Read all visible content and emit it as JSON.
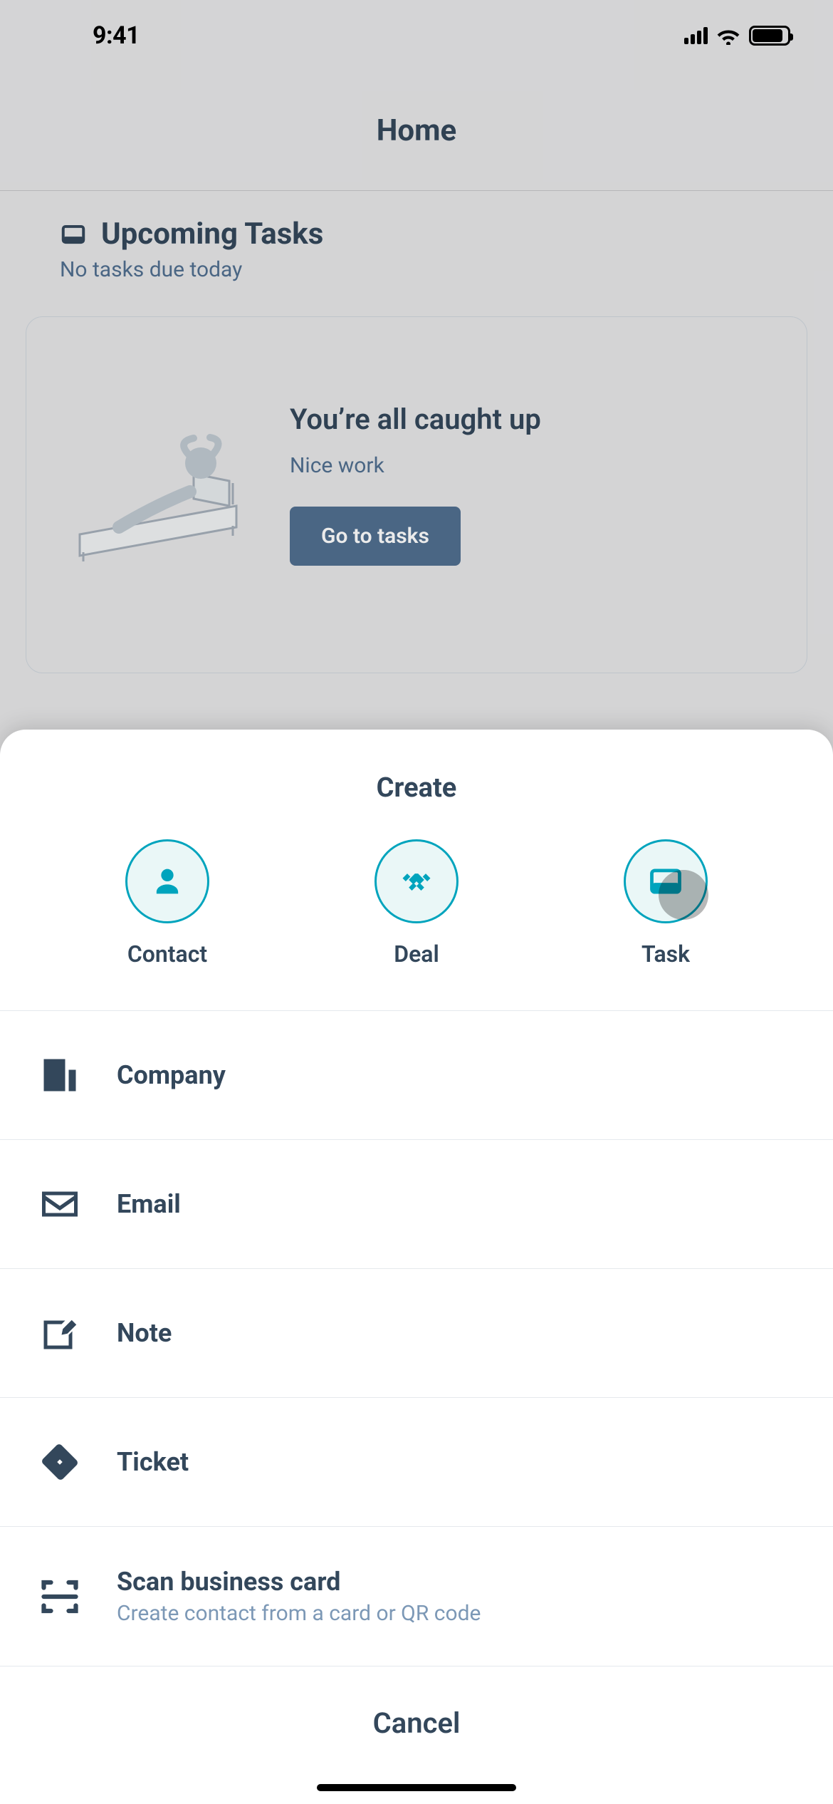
{
  "status": {
    "time": "9:41"
  },
  "header": {
    "title": "Home"
  },
  "upcoming": {
    "title": "Upcoming Tasks",
    "subtitle": "No tasks due today"
  },
  "card": {
    "title": "You’re all caught up",
    "subtitle": "Nice work",
    "button": "Go to tasks"
  },
  "sheet": {
    "title": "Create",
    "quick": {
      "contact": "Contact",
      "deal": "Deal",
      "task": "Task"
    },
    "list": {
      "company": "Company",
      "email": "Email",
      "note": "Note",
      "ticket": "Ticket",
      "scan_title": "Scan business card",
      "scan_sub": "Create contact from a card or QR code"
    },
    "cancel": "Cancel"
  },
  "colors": {
    "accent": "#00a4bd",
    "text_primary": "#33475b",
    "text_secondary": "#516f90",
    "button_bg": "#516f90"
  }
}
